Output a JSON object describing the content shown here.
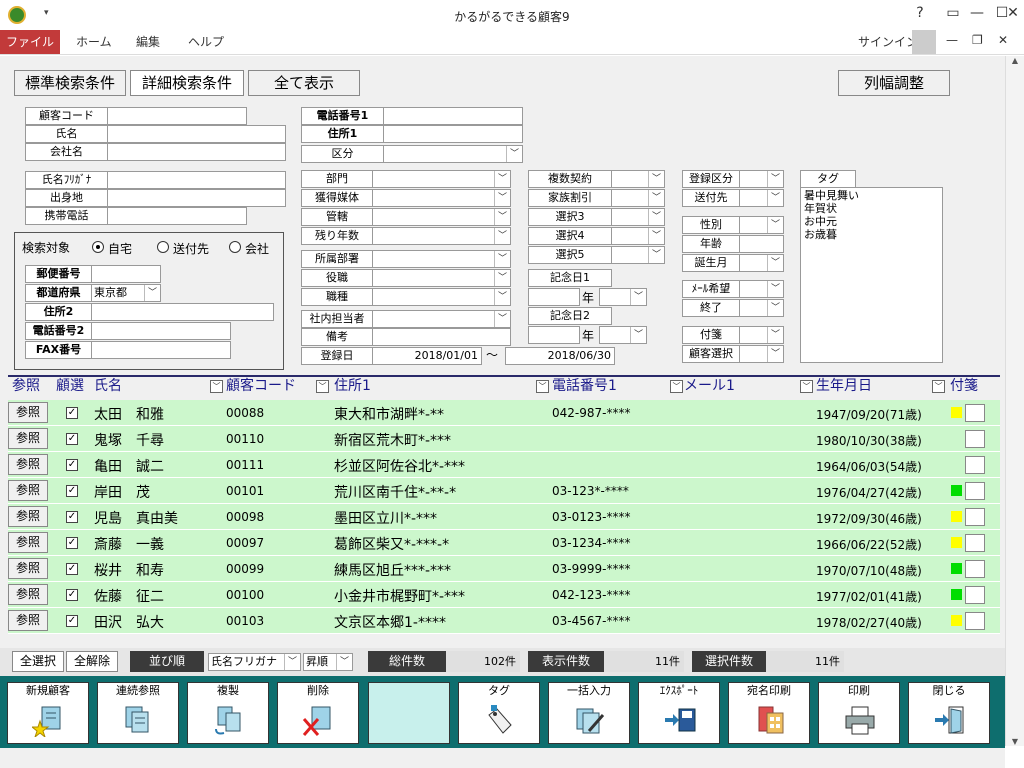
{
  "window": {
    "title": "かるがるできる顧客9",
    "help": "?"
  },
  "menu": {
    "file": "ファイル",
    "home": "ホーム",
    "edit": "編集",
    "help": "ヘルプ",
    "signin": "サインイン"
  },
  "tabs": {
    "standard": "標準検索条件",
    "detail": "詳細検索条件",
    "all": "全て表示",
    "colwidth": "列幅調整"
  },
  "form": {
    "customer_code": "顧客コード",
    "name": "氏名",
    "company": "会社名",
    "name_kana": "氏名ﾌﾘｶﾞﾅ",
    "birthplace": "出身地",
    "mobile": "携帯電話",
    "phone1": "電話番号1",
    "address1": "住所1",
    "category": "区分",
    "search_target": "検索対象",
    "opt_home": "自宅",
    "opt_dest": "送付先",
    "opt_company": "会社",
    "postal": "郵便番号",
    "prefecture": "都道府県",
    "prefecture_value": "東京都",
    "address2": "住所2",
    "phone2": "電話番号2",
    "fax": "FAX番号",
    "dept": "部門",
    "media": "獲得媒体",
    "jurisdiction": "管轄",
    "remaining": "残り年数",
    "affiliation": "所属部署",
    "position": "役職",
    "occupation": "職種",
    "staff": "社内担当者",
    "note": "備考",
    "regdate": "登録日",
    "regdate_from": "2018/01/01",
    "tilde": "〜",
    "regdate_to": "2018/06/30",
    "multi_contract": "複数契約",
    "family_discount": "家族割引",
    "sel3": "選択3",
    "sel4": "選択4",
    "sel5": "選択5",
    "anniv1": "記念日1",
    "anniv2": "記念日2",
    "year": "年",
    "reg_category": "登録区分",
    "send_to": "送付先",
    "gender": "性別",
    "age": "年齢",
    "birth_month": "誕生月",
    "mail_wish": "ﾒｰﾙ希望",
    "end": "終了",
    "sticky": "付箋",
    "cust_select": "顧客選択",
    "tag_label": "タグ",
    "tag_items": [
      "暑中見舞い",
      "年賀状",
      "お中元",
      "お歳暮"
    ]
  },
  "table": {
    "headers": {
      "ref": "参照",
      "select": "顧選",
      "name": "氏名",
      "code": "顧客コード",
      "address": "住所1",
      "phone": "電話番号1",
      "mail": "メール1",
      "birth": "生年月日",
      "tag": "付箋"
    },
    "ref_label": "参照",
    "rows": [
      {
        "name": "太田　和雅",
        "code": "00088",
        "address": "東大和市湖畔*-**",
        "phone": "042-987-****",
        "birth": "1947/09/20(71歳)",
        "tag": "#ffff00"
      },
      {
        "name": "鬼塚　千尋",
        "code": "00110",
        "address": "新宿区荒木町*-***",
        "phone": "",
        "birth": "1980/10/30(38歳)",
        "tag": ""
      },
      {
        "name": "亀田　誠二",
        "code": "00111",
        "address": "杉並区阿佐谷北*-***",
        "phone": "",
        "birth": "1964/06/03(54歳)",
        "tag": ""
      },
      {
        "name": "岸田　茂",
        "code": "00101",
        "address": "荒川区南千住*-**-*",
        "phone": "03-123*-****",
        "birth": "1976/04/27(42歳)",
        "tag": "#00dd00"
      },
      {
        "name": "児島　真由美",
        "code": "00098",
        "address": "墨田区立川*-***",
        "phone": "03-0123-****",
        "birth": "1972/09/30(46歳)",
        "tag": "#ffff00"
      },
      {
        "name": "斎藤　一義",
        "code": "00097",
        "address": "葛飾区柴又*-***-*",
        "phone": "03-1234-****",
        "birth": "1966/06/22(52歳)",
        "tag": "#ffff00"
      },
      {
        "name": "桜井　和寿",
        "code": "00099",
        "address": "練馬区旭丘***-***",
        "phone": "03-9999-****",
        "birth": "1970/07/10(48歳)",
        "tag": "#00dd00"
      },
      {
        "name": "佐藤　征二",
        "code": "00100",
        "address": "小金井市梶野町*-***",
        "phone": "042-123-****",
        "birth": "1977/02/01(41歳)",
        "tag": "#00dd00"
      },
      {
        "name": "田沢　弘大",
        "code": "00103",
        "address": "文京区本郷1-****",
        "phone": "03-4567-****",
        "birth": "1978/02/27(40歳)",
        "tag": "#ffff00"
      }
    ]
  },
  "status": {
    "select_all": "全選択",
    "deselect_all": "全解除",
    "sort_label": "並び順",
    "sort_field": "氏名フリガナ",
    "sort_dir": "昇順",
    "total_label": "総件数",
    "total_value": "102件",
    "shown_label": "表示件数",
    "shown_value": "11件",
    "selected_label": "選択件数",
    "selected_value": "11件"
  },
  "toolbar": {
    "new": "新規顧客",
    "continuous": "連続参照",
    "copy": "複製",
    "delete": "削除",
    "tag": "タグ",
    "bulk": "一括入力",
    "export": "ｴｸｽﾎﾟｰﾄ",
    "label_print": "宛名印刷",
    "print": "印刷",
    "close": "閉じる"
  }
}
